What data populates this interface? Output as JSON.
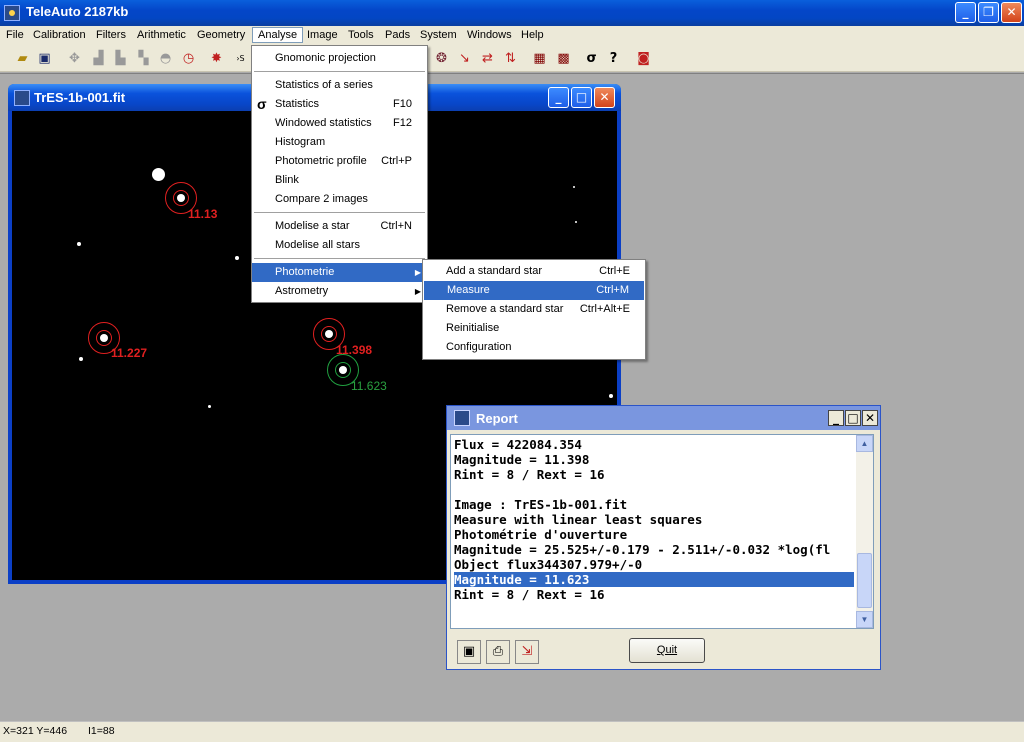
{
  "app": {
    "title": "TeleAuto 2187kb"
  },
  "menubar": [
    "File",
    "Calibration",
    "Filters",
    "Arithmetic",
    "Geometry",
    "Analyse",
    "Image",
    "Tools",
    "Pads",
    "System",
    "Windows",
    "Help"
  ],
  "image_window": {
    "title": "TrES-1b-001.fit",
    "star_labels": [
      "11.13",
      "11.227",
      "11.398",
      "11.623"
    ]
  },
  "analyse_menu": {
    "items": [
      {
        "label": "Gnomonic projection",
        "shortcut": ""
      },
      {
        "label": "Statistics of a series",
        "shortcut": ""
      },
      {
        "label": "Statistics",
        "shortcut": "F10"
      },
      {
        "label": "Windowed statistics",
        "shortcut": "F12"
      },
      {
        "label": "Histogram",
        "shortcut": ""
      },
      {
        "label": "Photometric profile",
        "shortcut": "Ctrl+P"
      },
      {
        "label": "Blink",
        "shortcut": ""
      },
      {
        "label": "Compare 2 images",
        "shortcut": ""
      },
      {
        "label": "Modelise a star",
        "shortcut": "Ctrl+N"
      },
      {
        "label": "Modelise all stars",
        "shortcut": ""
      },
      {
        "label": "Photometrie",
        "shortcut": ""
      },
      {
        "label": "Astrometry",
        "shortcut": ""
      }
    ]
  },
  "photometrie_submenu": {
    "items": [
      {
        "label": "Add a standard star",
        "shortcut": "Ctrl+E"
      },
      {
        "label": "Measure",
        "shortcut": "Ctrl+M"
      },
      {
        "label": "Remove a standard star",
        "shortcut": "Ctrl+Alt+E"
      },
      {
        "label": "Reinitialise",
        "shortcut": ""
      },
      {
        "label": "Configuration",
        "shortcut": ""
      }
    ]
  },
  "report": {
    "title": "Report",
    "lines": [
      "Flux = 422084.354",
      "Magnitude = 11.398",
      "Rint = 8 / Rext = 16",
      "",
      "Image : TrES-1b-001.fit",
      "Measure with linear least squares",
      "Photométrie d'ouverture",
      "Magnitude = 25.525+/-0.179 - 2.511+/-0.032 *log(fl",
      "Object flux344307.979+/-0",
      "Magnitude = 11.623",
      "Rint = 8 / Rext = 16"
    ],
    "quit_label": "Quit"
  },
  "statusbar": {
    "coords": "X=321 Y=446",
    "intensity": "I1=88"
  },
  "colors": {
    "accent": "#316ac5",
    "star_label": "#e02020",
    "green_label": "#2aa040"
  }
}
